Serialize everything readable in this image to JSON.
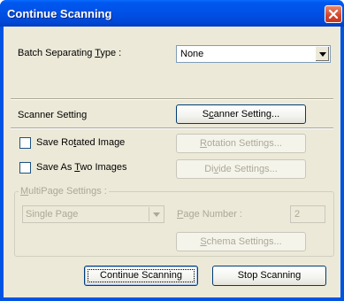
{
  "window": {
    "title": "Continue Scanning"
  },
  "batch": {
    "label_pre": "Batch Separating ",
    "label_key": "T",
    "label_post": "ype :",
    "value": "None"
  },
  "scanner": {
    "label": "Scanner Setting",
    "button_pre": "S",
    "button_key": "c",
    "button_post": "anner Setting..."
  },
  "rotate": {
    "label_pre": "Save Ro",
    "label_key": "t",
    "label_post": "ated Image",
    "button_key": "R",
    "button_post": "otation Settings..."
  },
  "divide": {
    "label_pre": "Save As ",
    "label_key": "T",
    "label_post": "wo Images",
    "button_pre": "Di",
    "button_key": "v",
    "button_post": "ide Settings..."
  },
  "multipage": {
    "legend_key": "M",
    "legend_post": "ultiPage Settings :",
    "select_value": "Single Page",
    "page_number_key": "P",
    "page_number_post": "age Number :",
    "page_number_value": "2",
    "schema_key": "S",
    "schema_post": "chema Settings..."
  },
  "footer": {
    "continue_label": "Continue Scanning",
    "stop_label": "Stop Scanning"
  }
}
